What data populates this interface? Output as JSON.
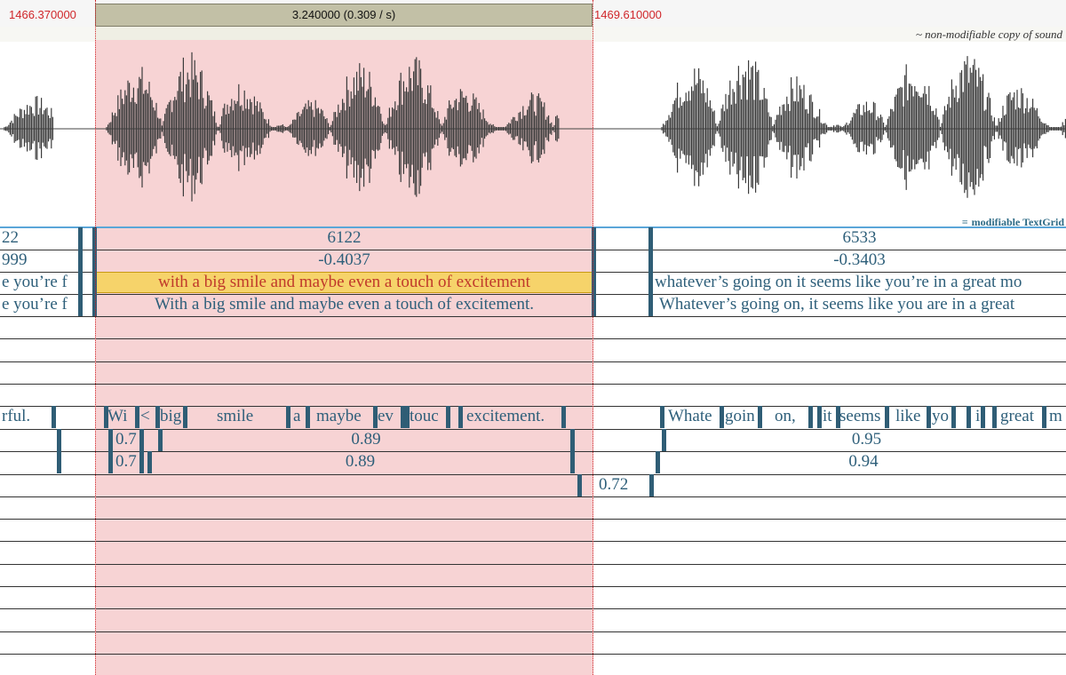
{
  "time_bar": {
    "left_time": "1466.370000",
    "selection_duration": "3.240000 (0.309 / s)",
    "right_time": "1469.610000"
  },
  "sound_caption": "~ non-modifiable copy of sound",
  "textgrid_caption": "modifiable TextGrid",
  "colors": {
    "selection": "#f7d3d4",
    "highlight": "#f6d36a",
    "tier_text": "#2e5f7a",
    "time_label": "#d0262a"
  },
  "tiers": {
    "id": {
      "left_fragment": "22",
      "selected": "6122",
      "right": "6533"
    },
    "score": {
      "left_fragment": "999",
      "selected": "-0.4037",
      "right": "-0.3403"
    },
    "raw": {
      "left_fragment": "e you’re f",
      "selected": "with a big smile and maybe even a touch of excitement",
      "right": "whatever’s going on it seems like you’re in a great mo"
    },
    "normalized": {
      "left_fragment": "e you’re f",
      "selected": "With a big smile and maybe even a touch of excitement.",
      "right": "Whatever’s going on, it seems like you are in a great"
    },
    "words": {
      "left_fragment": "rful.",
      "selected": [
        "Wi",
        "<",
        "big",
        "smile",
        "a",
        "maybe",
        "ev",
        "touc",
        "excitement."
      ],
      "right": [
        "Whate",
        "goin",
        "on,",
        "it",
        "seems",
        "like",
        "yo",
        "i",
        "great",
        "m"
      ]
    },
    "conf_a": {
      "selected_first": "0.7",
      "selected_main": "0.89",
      "right": "0.95"
    },
    "conf_b": {
      "selected_first": "0.7",
      "selected_main": "0.89",
      "right": "0.94"
    },
    "conf_c": {
      "gap": "0.72"
    }
  }
}
